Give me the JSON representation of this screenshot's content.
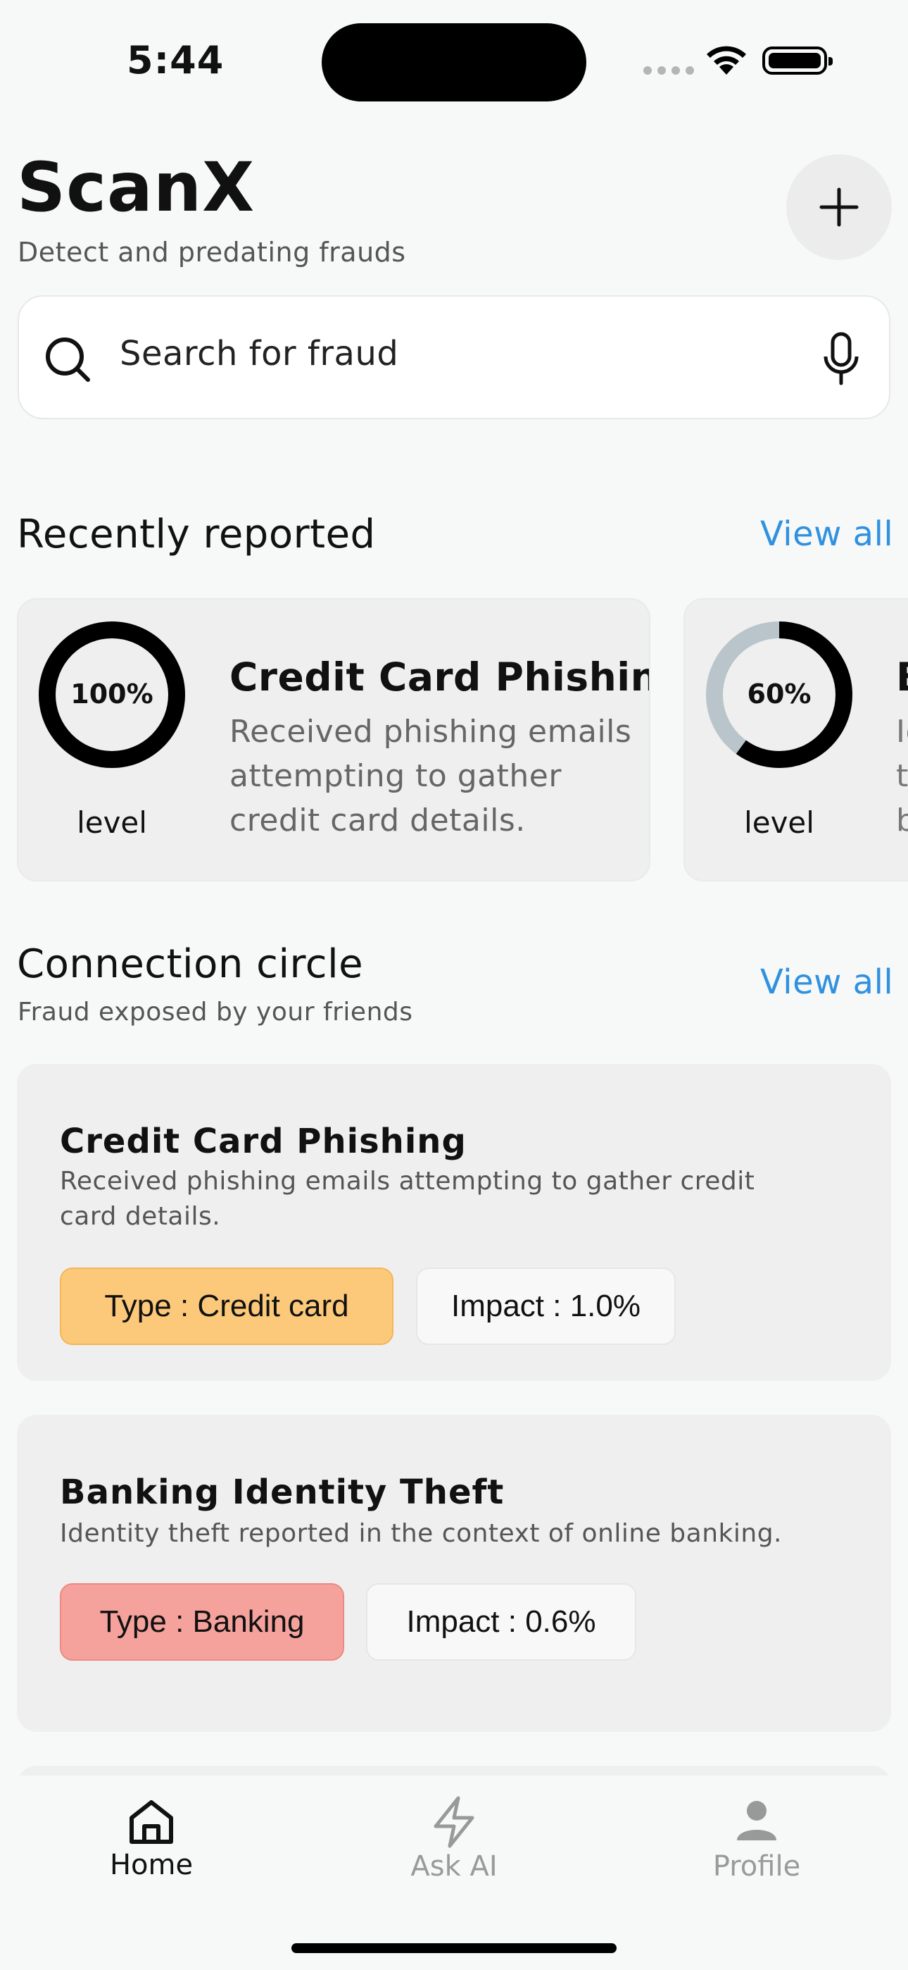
{
  "status": {
    "time": "5:44"
  },
  "header": {
    "title": "ScanX",
    "subtitle": "Detect and predating frauds"
  },
  "search": {
    "placeholder": "Search for fraud"
  },
  "recent": {
    "title": "Recently reported",
    "view_all": "View all",
    "cards": [
      {
        "percent": "100%",
        "level_value": 1.0,
        "level_label": "level",
        "title": "Credit Card Phishing",
        "description": "Received phishing emails attempting to gather credit card details."
      },
      {
        "percent": "60%",
        "level_value": 0.6,
        "level_label": "level",
        "title": "B",
        "description": "Id\nt\nb"
      }
    ]
  },
  "connections": {
    "title": "Connection circle",
    "subtitle": "Fraud exposed by your friends",
    "view_all": "View all",
    "cards": [
      {
        "title": "Credit Card Phishing",
        "description": "Received phishing emails attempting to gather credit card details.",
        "type": "Type : Credit card",
        "impact": "Impact : 1.0%"
      },
      {
        "title": "Banking Identity Theft",
        "description": "Identity theft reported in the context of online banking.",
        "type": "Type : Banking",
        "impact": "Impact : 0.6%"
      }
    ]
  },
  "nav": {
    "items": [
      {
        "label": "Home",
        "active": true
      },
      {
        "label": "Ask AI",
        "active": false
      },
      {
        "label": "Profile",
        "active": false
      }
    ]
  },
  "colors": {
    "accent": "#2f91e0",
    "chip_credit_card": "#fcc97a",
    "chip_banking": "#f5a29d",
    "donut_track": "#b9c5ca"
  }
}
